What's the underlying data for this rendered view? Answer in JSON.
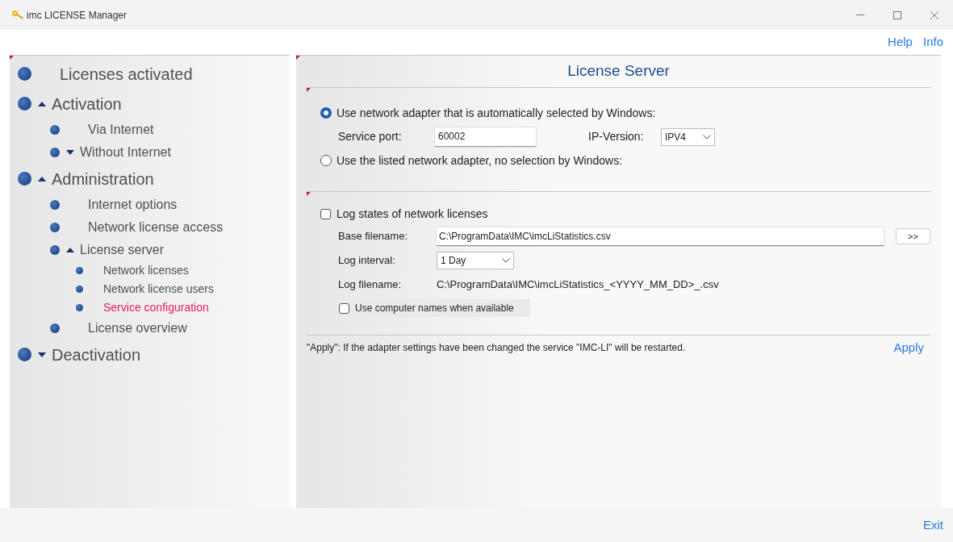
{
  "window": {
    "title": "imc LICENSE Manager"
  },
  "top_links": [
    "Help",
    "Info"
  ],
  "sidebar": {
    "items": [
      {
        "label": "Licenses activated",
        "selected": false
      },
      {
        "label": "Activation",
        "selected": false,
        "expanded": true,
        "children": [
          {
            "label": "Via Internet",
            "selected": false
          },
          {
            "label": "Without Internet",
            "selected": false,
            "expanded": false
          }
        ]
      },
      {
        "label": "Administration",
        "selected": false,
        "expanded": true,
        "children": [
          {
            "label": "Internet options",
            "selected": false
          },
          {
            "label": "Network license access",
            "selected": false
          },
          {
            "label": "License server",
            "selected": false,
            "expanded": true,
            "children": [
              {
                "label": "Network licenses",
                "selected": false
              },
              {
                "label": "Network license users",
                "selected": false
              },
              {
                "label": "Service configuration",
                "selected": true
              }
            ]
          },
          {
            "label": "License overview",
            "selected": false
          }
        ]
      },
      {
        "label": "Deactivation",
        "selected": false,
        "expanded": false
      }
    ]
  },
  "panel": {
    "title": "License Server",
    "adapter_options": [
      {
        "label": "Use network adapter that is automatically selected by Windows:",
        "selected": true
      },
      {
        "label": "Use the listed network adapter, no selection by Windows:",
        "selected": false
      }
    ],
    "service_port": {
      "label": "Service port:",
      "value": "60002"
    },
    "ip_version": {
      "label": "IP-Version:",
      "value": "IPV4"
    },
    "log_states": {
      "label": "Log states of network licenses",
      "checked": false
    },
    "base_filename": {
      "label": "Base filename:",
      "value": "C:\\ProgramData\\IMC\\imcLiStatistics.csv",
      "button": ">>"
    },
    "log_interval": {
      "label": "Log interval:",
      "value": "1 Day"
    },
    "log_filename": {
      "label": "Log filename:",
      "value": "C:\\ProgramData\\IMC\\imcLiStatistics_<YYYY_MM_DD>_.csv"
    },
    "computer_names": {
      "label": "Use computer names when available",
      "checked": false
    },
    "note": "\"Apply\": If the adapter settings have been changed the service \"IMC-LI\" will be restarted.",
    "apply": "Apply"
  },
  "footer": {
    "exit": "Exit"
  }
}
